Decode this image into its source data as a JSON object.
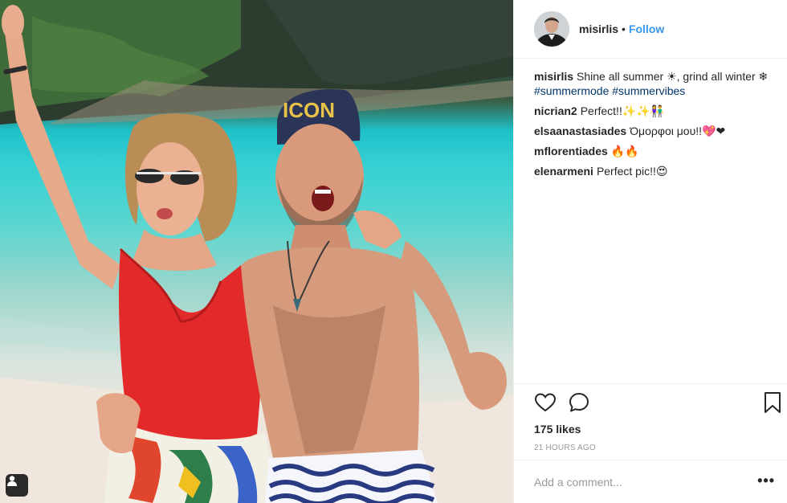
{
  "post": {
    "username": "misirlis",
    "separator": "•",
    "follow_label": "Follow",
    "caption": {
      "user": "misirlis",
      "text": "Shine all summer ☀, grind all winter ❄",
      "hashtags": [
        "#summermode",
        "#summervibes"
      ]
    },
    "comments": [
      {
        "user": "nicrian2",
        "text": "Perfect!!✨✨👫"
      },
      {
        "user": "elsaanastasiades",
        "text": "Όμορφοι μου!!💖❤"
      },
      {
        "user": "mflorentiades",
        "text": "🔥🔥"
      },
      {
        "user": "elenarmeni",
        "text": "Perfect pic!!😍"
      }
    ],
    "likes": "175 likes",
    "timestamp": "21 HOURS AGO",
    "comment_placeholder": "Add a comment...",
    "more_options": "•••"
  },
  "icons": {
    "like": "heart-icon",
    "comment": "comment-icon",
    "save": "bookmark-icon",
    "tags": "user-tag-icon"
  },
  "colors": {
    "link": "#3897f0",
    "hashtag": "#003569",
    "muted": "#999999",
    "text": "#262626",
    "border": "#efefef"
  }
}
